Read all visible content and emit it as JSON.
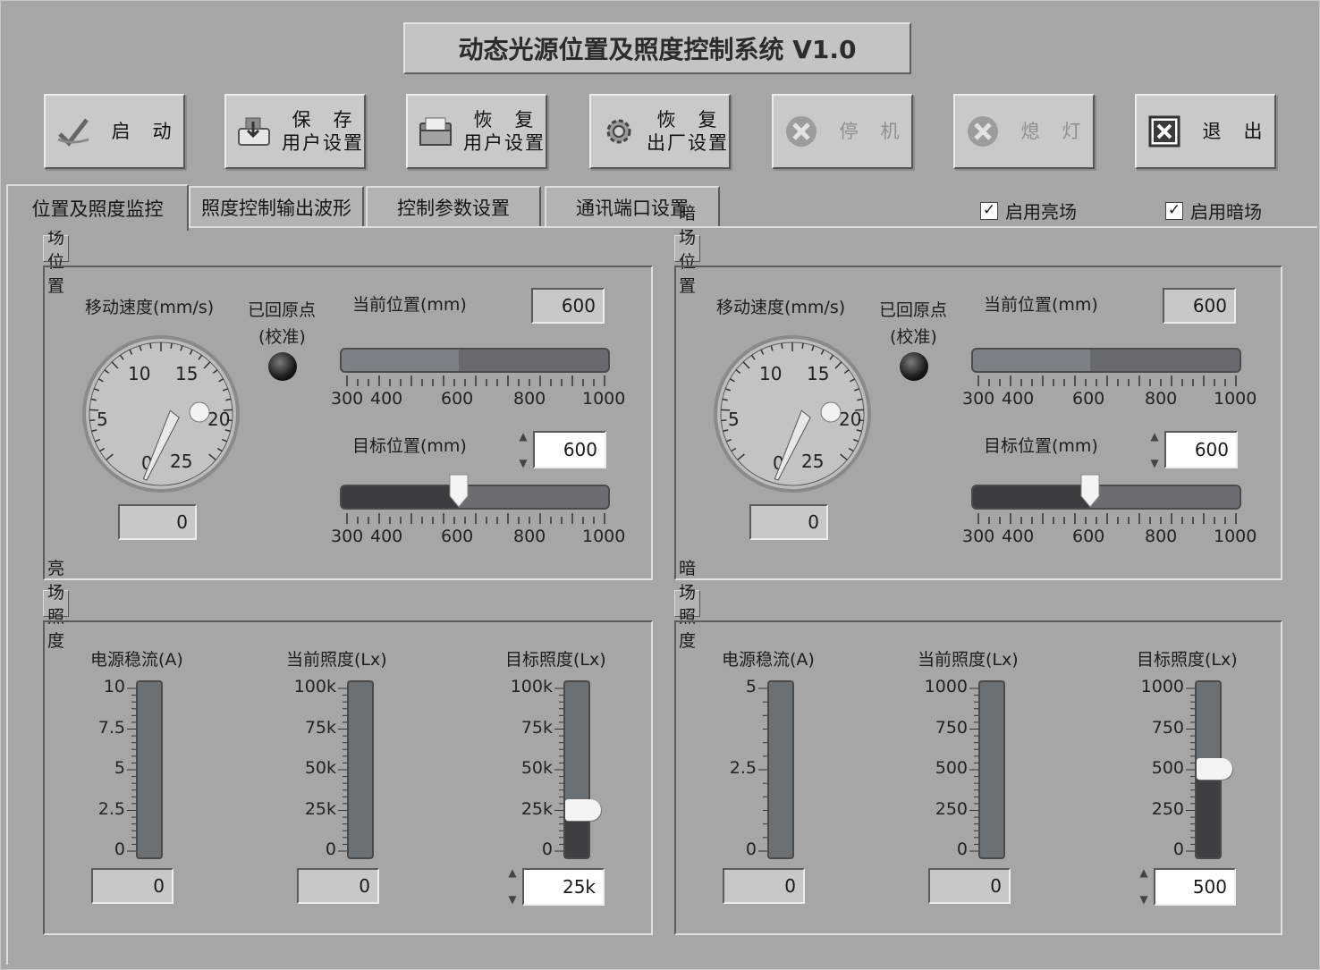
{
  "title": "动态光源位置及照度控制系统 V1.0",
  "toolbar": [
    {
      "l1": "启　动",
      "l2": "",
      "icon": "check-icon",
      "enabled": true
    },
    {
      "l1": "保　存",
      "l2": "用户设置",
      "icon": "save-icon",
      "enabled": true
    },
    {
      "l1": "恢　复",
      "l2": "用户设置",
      "icon": "folder-icon",
      "enabled": true
    },
    {
      "l1": "恢　复",
      "l2": "出厂设置",
      "icon": "gear-icon",
      "enabled": true
    },
    {
      "l1": "停　机",
      "l2": "",
      "icon": "stop-icon",
      "enabled": false
    },
    {
      "l1": "熄　灯",
      "l2": "",
      "icon": "stop-icon",
      "enabled": false
    },
    {
      "l1": "退　出",
      "l2": "",
      "icon": "close-icon",
      "enabled": true
    }
  ],
  "tabs": [
    "位置及照度监控",
    "照度控制输出波形",
    "控制参数设置",
    "通讯端口设置"
  ],
  "checkboxes": {
    "bright": "启用亮场",
    "dark": "启用暗场"
  },
  "position": {
    "bright_title": "亮场位置",
    "dark_title": "暗场位置",
    "speed_label": "移动速度(mm/s)",
    "home_l1": "已回原点",
    "home_l2": "(校准)",
    "cur_label": "当前位置(mm)",
    "target_label": "目标位置(mm)",
    "dial_ticks": [
      "0",
      "5",
      "10",
      "15",
      "20",
      "25"
    ],
    "scale_ticks": [
      "300",
      "400",
      "600",
      "800",
      "1000"
    ],
    "bright": {
      "speed": "0",
      "current": "600",
      "target": "600",
      "current_frac": 0.44,
      "target_frac": 0.44
    },
    "dark": {
      "speed": "0",
      "current": "600",
      "target": "600",
      "current_frac": 0.44,
      "target_frac": 0.44
    }
  },
  "illum": {
    "bright_title": "亮场照度",
    "dark_title": "暗场照度",
    "psu_label": "电源稳流(A)",
    "cur_label": "当前照度(Lx)",
    "target_label": "目标照度(Lx)",
    "bright": {
      "psu_ticks": [
        "10",
        "7.5",
        "5",
        "2.5",
        "0"
      ],
      "psu": "0",
      "cur_ticks": [
        "100k",
        "75k",
        "50k",
        "25k",
        "0"
      ],
      "cur": "0",
      "tgt_ticks": [
        "100k",
        "75k",
        "50k",
        "25k",
        "0"
      ],
      "tgt": "25k",
      "tgt_frac": 0.25
    },
    "dark": {
      "psu_ticks": [
        "5",
        "2.5",
        "0"
      ],
      "psu": "0",
      "cur_ticks": [
        "1000",
        "750",
        "500",
        "250",
        "0"
      ],
      "cur": "0",
      "tgt_ticks": [
        "1000",
        "750",
        "500",
        "250",
        "0"
      ],
      "tgt": "500",
      "tgt_frac": 0.5
    }
  }
}
